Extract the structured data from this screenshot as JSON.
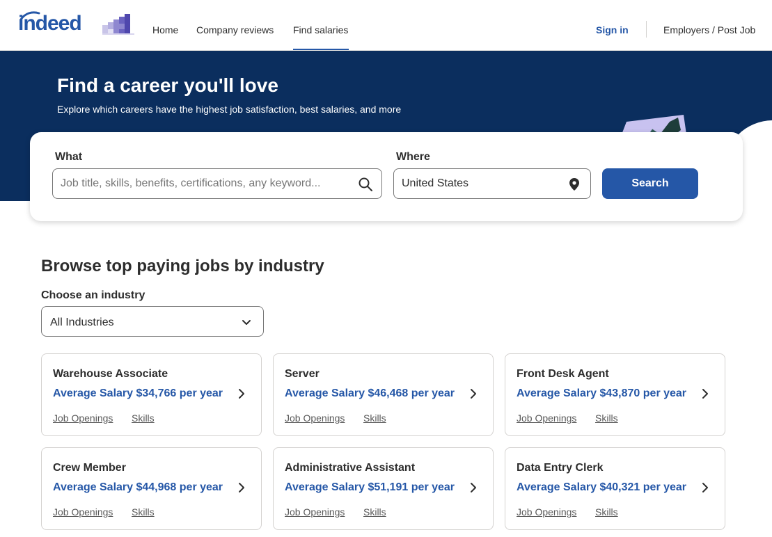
{
  "header": {
    "logo_text": "indeed",
    "nav": [
      "Home",
      "Company reviews",
      "Find salaries"
    ],
    "active_nav": "Find salaries",
    "sign_in": "Sign in",
    "employers": "Employers / Post Job"
  },
  "hero": {
    "title": "Find a career you'll love",
    "subtitle": "Explore which careers have the highest job satisfaction, best salaries, and more"
  },
  "search": {
    "what_label": "What",
    "what_placeholder": "Job title, skills, benefits, certifications, any keyword...",
    "where_label": "Where",
    "where_value": "United States",
    "button": "Search"
  },
  "browse": {
    "title": "Browse top paying jobs by industry",
    "choose_label": "Choose an industry",
    "selected_industry": "All Industries"
  },
  "jobs": [
    {
      "title": "Warehouse Associate",
      "salary": "Average Salary $34,766 per year",
      "openings": "Job Openings",
      "skills": "Skills"
    },
    {
      "title": "Server",
      "salary": "Average Salary $46,468 per year",
      "openings": "Job Openings",
      "skills": "Skills"
    },
    {
      "title": "Front Desk Agent",
      "salary": "Average Salary $43,870 per year",
      "openings": "Job Openings",
      "skills": "Skills"
    },
    {
      "title": "Crew Member",
      "salary": "Average Salary $44,968 per year",
      "openings": "Job Openings",
      "skills": "Skills"
    },
    {
      "title": "Administrative Assistant",
      "salary": "Average Salary $51,191 per year",
      "openings": "Job Openings",
      "skills": "Skills"
    },
    {
      "title": "Data Entry Clerk",
      "salary": "Average Salary $40,321 per year",
      "openings": "Job Openings",
      "skills": "Skills"
    }
  ],
  "colors": {
    "brand_blue": "#2557a7",
    "hero_navy": "#0b2e5e",
    "text": "#2d2d2d"
  },
  "icons": [
    "indeed-logo",
    "company-bars-icon",
    "search-icon",
    "location-pin-icon",
    "chevron-down-icon",
    "chevron-right-icon",
    "briefcase-illustration"
  ]
}
